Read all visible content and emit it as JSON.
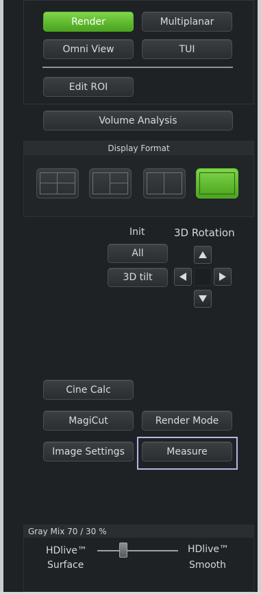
{
  "top": {
    "render_label": "Render",
    "multiplanar_label": "Multiplanar",
    "omni_view_label": "Omni View",
    "tui_label": "TUI",
    "edit_roi_label": "Edit ROI",
    "volume_analysis_label": "Volume Analysis"
  },
  "display_format": {
    "title": "Display Format",
    "options": [
      {
        "icon": "quad-layout-icon"
      },
      {
        "icon": "split-right-layout-icon"
      },
      {
        "icon": "dual-layout-icon"
      },
      {
        "icon": "single-layout-icon",
        "selected": true
      }
    ]
  },
  "init": {
    "title": "Init",
    "all_label": "All",
    "tilt_label": "3D tilt"
  },
  "rotation": {
    "title": "3D Rotation"
  },
  "tools": {
    "cine_calc_label": "Cine Calc",
    "magicut_label": "MagiCut",
    "render_mode_label": "Render Mode",
    "image_settings_label": "Image Settings",
    "measure_label": "Measure"
  },
  "gray_mix": {
    "title": "Gray Mix 70 / 30 %",
    "left_line1": "HDlive™",
    "left_line2": "Surface",
    "right_line1": "HDlive™",
    "right_line2": "Smooth",
    "value_fraction": 0.3
  },
  "colors": {
    "accent_green": "#5cbc2a",
    "measure_outline": "#b8b5e6"
  }
}
